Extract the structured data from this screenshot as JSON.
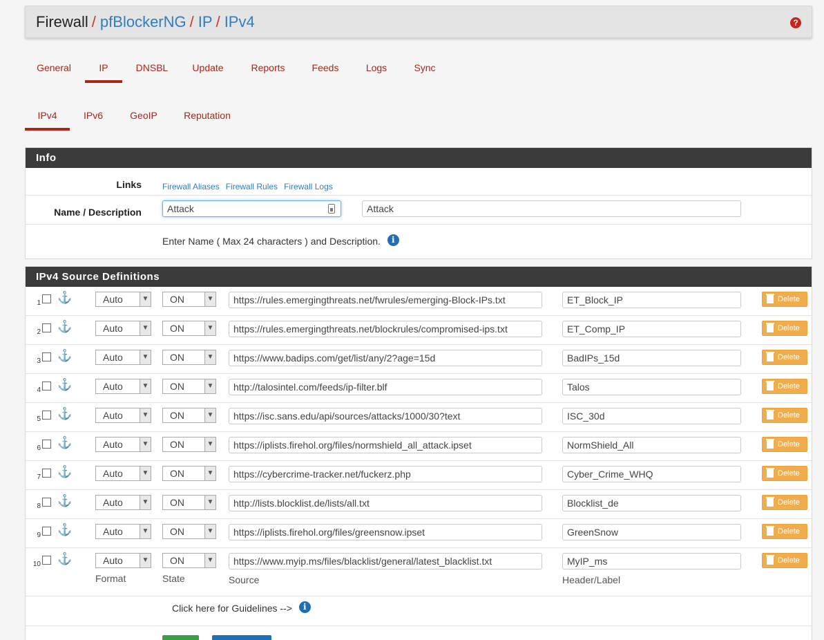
{
  "breadcrumb": {
    "items": [
      "Firewall",
      "pfBlockerNG",
      "IP",
      "IPv4"
    ]
  },
  "tabs_main": [
    {
      "label": "General",
      "width": 84
    },
    {
      "label": "IP",
      "width": 54,
      "active": true
    },
    {
      "label": "DNSBL",
      "width": 86
    },
    {
      "label": "Update",
      "width": 80
    },
    {
      "label": "Reports",
      "width": 92
    },
    {
      "label": "Feeds",
      "width": 74
    },
    {
      "label": "Logs",
      "width": 74
    },
    {
      "label": "Sync",
      "width": 66
    }
  ],
  "tabs_sub": [
    {
      "label": "IPv4",
      "active": true
    },
    {
      "label": "IPv6"
    },
    {
      "label": "GeoIP"
    },
    {
      "label": "Reputation"
    }
  ],
  "info": {
    "heading": "Info",
    "links_label": "Links",
    "links": [
      "Firewall Aliases",
      "Firewall Rules",
      "Firewall Logs"
    ],
    "name_label": "Name / Description",
    "name_value": "Attack",
    "description_value": "Attack",
    "help_text": "Enter Name ( Max 24 characters ) and Description."
  },
  "sources": {
    "heading": "IPv4 Source Definitions",
    "rows": [
      {
        "num": "1",
        "format": "Auto",
        "state": "ON",
        "source": "https://rules.emergingthreats.net/fwrules/emerging-Block-IPs.txt",
        "label": "ET_Block_IP"
      },
      {
        "num": "2",
        "format": "Auto",
        "state": "ON",
        "source": "https://rules.emergingthreats.net/blockrules/compromised-ips.txt",
        "label": "ET_Comp_IP"
      },
      {
        "num": "3",
        "format": "Auto",
        "state": "ON",
        "source": "https://www.badips.com/get/list/any/2?age=15d",
        "label": "BadIPs_15d"
      },
      {
        "num": "4",
        "format": "Auto",
        "state": "ON",
        "source": "http://talosintel.com/feeds/ip-filter.blf",
        "label": "Talos"
      },
      {
        "num": "5",
        "format": "Auto",
        "state": "ON",
        "source": "https://isc.sans.edu/api/sources/attacks/1000/30?text",
        "label": "ISC_30d"
      },
      {
        "num": "6",
        "format": "Auto",
        "state": "ON",
        "source": "https://iplists.firehol.org/files/normshield_all_attack.ipset",
        "label": "NormShield_All"
      },
      {
        "num": "7",
        "format": "Auto",
        "state": "ON",
        "source": "https://cybercrime-tracker.net/fuckerz.php",
        "label": "Cyber_Crime_WHQ"
      },
      {
        "num": "8",
        "format": "Auto",
        "state": "ON",
        "source": "http://lists.blocklist.de/lists/all.txt",
        "label": "Blocklist_de"
      },
      {
        "num": "9",
        "format": "Auto",
        "state": "ON",
        "source": "https://iplists.firehol.org/files/greensnow.ipset",
        "label": "GreenSnow"
      },
      {
        "num": "10",
        "format": "Auto",
        "state": "ON",
        "source": "https://www.myip.ms/files/blacklist/general/latest_blacklist.txt",
        "label": "MyIP_ms"
      }
    ],
    "delete_label": "Delete",
    "col_format": "Format",
    "col_state": "State",
    "col_source": "Source",
    "col_label": "Header/Label",
    "guidelines_text": "Click here for Guidelines -->"
  }
}
